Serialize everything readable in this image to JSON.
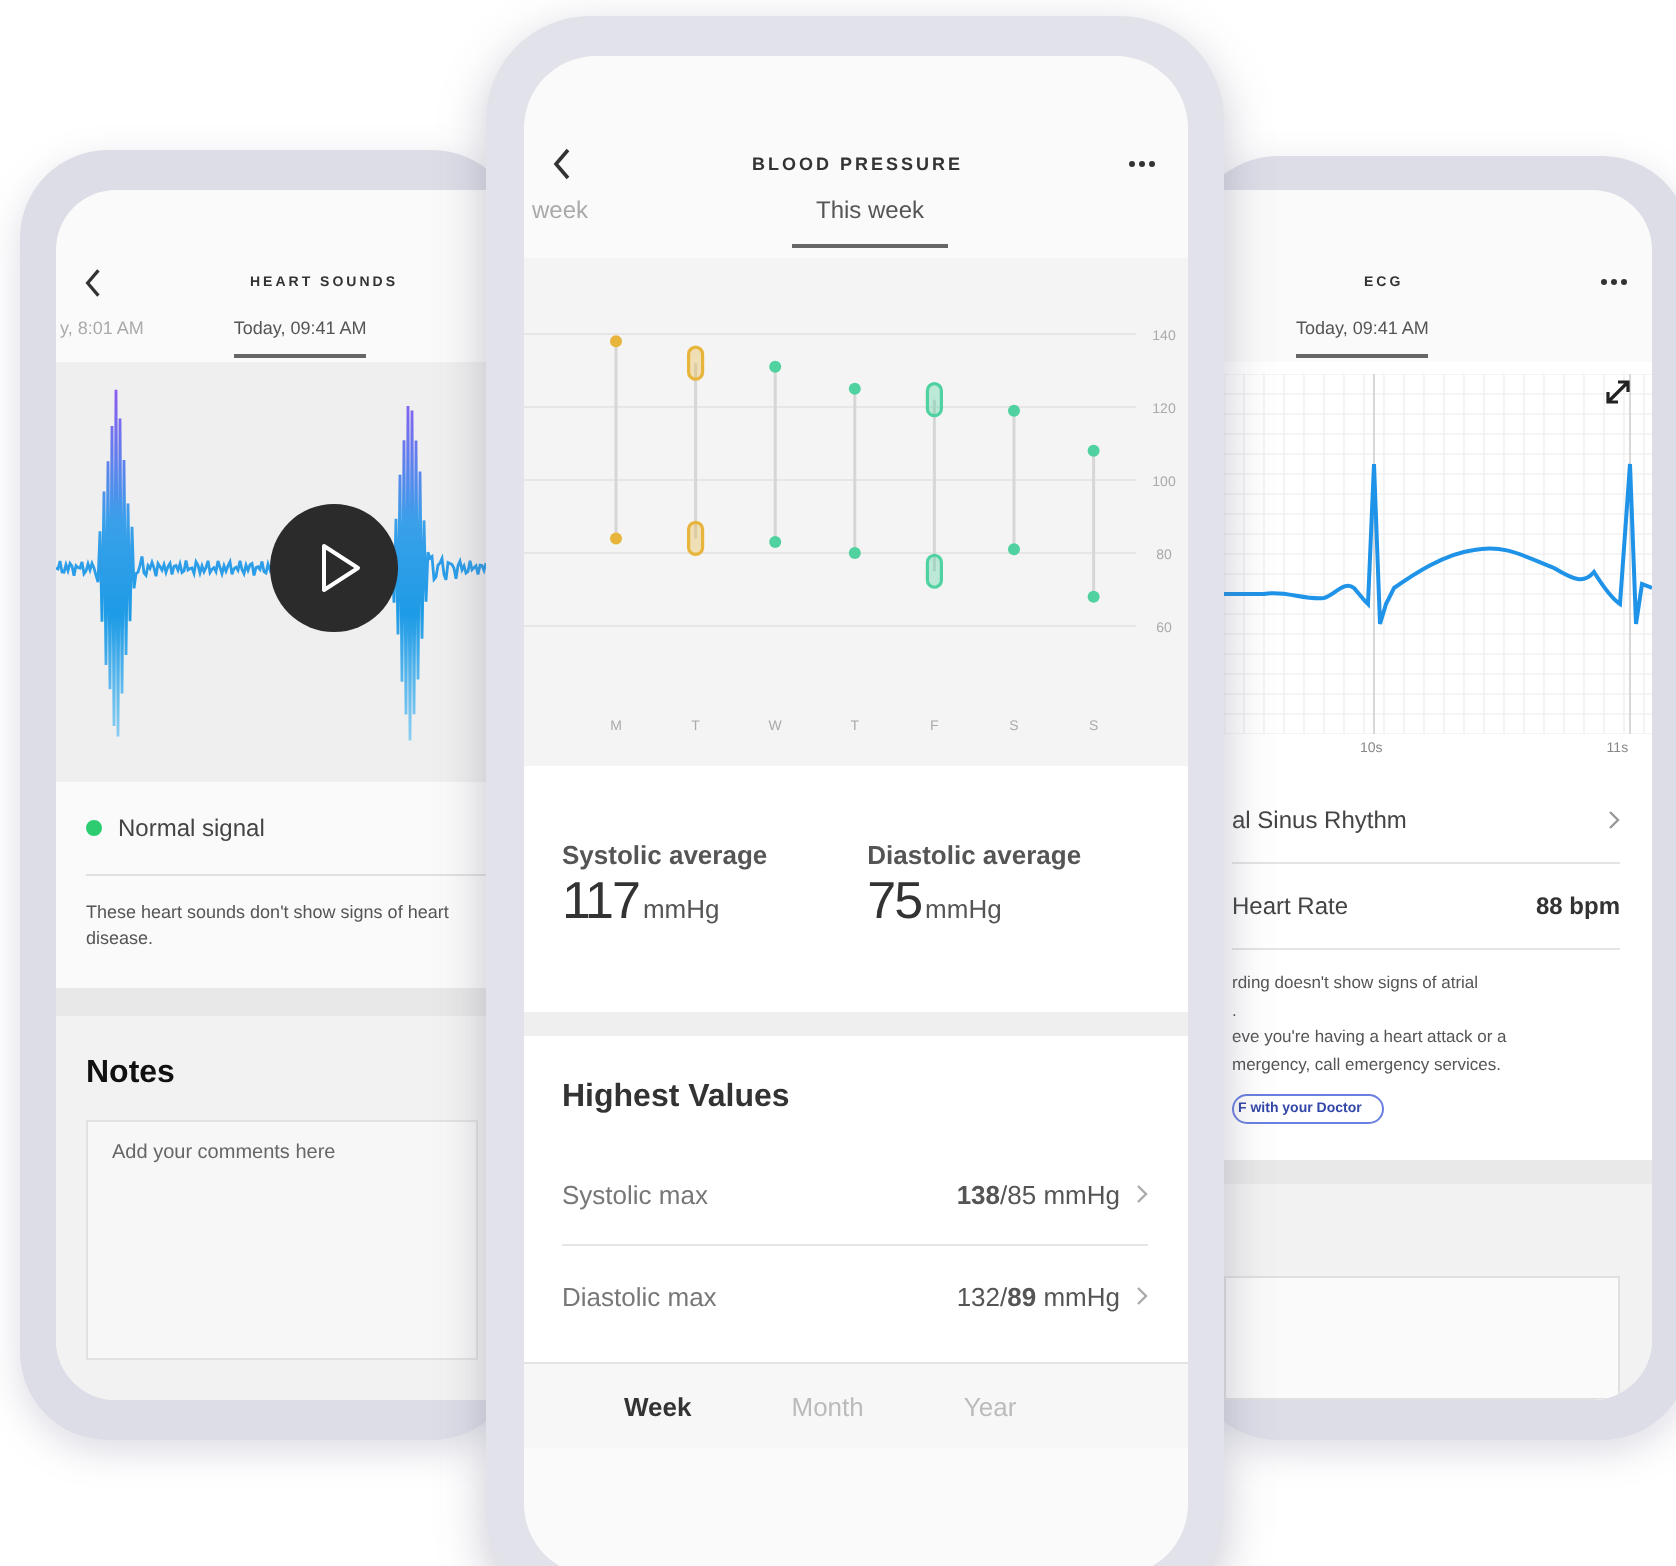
{
  "heart_sounds_screen": {
    "title": "HEART SOUNDS",
    "tabs": [
      {
        "label": "y, 8:01 AM",
        "selected": false
      },
      {
        "label": "Today, 09:41 AM",
        "selected": true
      }
    ],
    "status": {
      "label": "Normal signal",
      "color": "#2ecc71"
    },
    "description": "These heart sounds don't show signs of heart disease.",
    "notes": {
      "heading": "Notes",
      "placeholder": "Add your comments here"
    }
  },
  "blood_pressure_screen": {
    "title": "BLOOD PRESSURE",
    "tabs": [
      {
        "label": "week",
        "selected": false
      },
      {
        "label": "This week",
        "selected": true
      }
    ],
    "chart_data": {
      "type": "scatter",
      "categories": [
        "M",
        "T",
        "W",
        "T",
        "F",
        "S",
        "S"
      ],
      "ylim": [
        60,
        140
      ],
      "yticks": [
        60,
        80,
        100,
        120,
        140
      ],
      "series": [
        {
          "color": "#e8b53c",
          "values": [
            138,
            132,
            null,
            null,
            null,
            null,
            null
          ]
        },
        {
          "color": "#e8b53c",
          "values": [
            84,
            84,
            null,
            null,
            null,
            null,
            null
          ]
        },
        {
          "color": "#4fd1a0",
          "values": [
            null,
            null,
            131,
            125,
            122,
            119,
            108
          ]
        },
        {
          "color": "#4fd1a0",
          "values": [
            null,
            null,
            83,
            80,
            75,
            81,
            68
          ]
        }
      ],
      "grid": true,
      "annotations": [
        {
          "x": "T"
        },
        {
          "x": "F"
        }
      ]
    },
    "averages": [
      {
        "label": "Systolic average",
        "value": "117",
        "unit": "mmHg"
      },
      {
        "label": "Diastolic average",
        "value": "75",
        "unit": "mmHg"
      }
    ],
    "highest_values": {
      "heading": "Highest Values",
      "rows": [
        {
          "label": "Systolic max",
          "value": "**138**/85 mmHg"
        },
        {
          "label": "Diastolic max",
          "value": "132/**89** mmHg"
        }
      ]
    },
    "bottom_tabs": [
      {
        "label": "Week",
        "selected": true
      },
      {
        "label": "Month",
        "selected": false
      },
      {
        "label": "Year",
        "selected": false
      }
    ]
  },
  "ecg_screen": {
    "title": "ECG",
    "tabs": [
      {
        "label": "Today, 09:41 AM",
        "selected": true
      }
    ],
    "time_labels": [
      "10s",
      "11s"
    ],
    "rows": [
      {
        "kind": "link",
        "label": "al Sinus Rhythm"
      },
      {
        "kind": "value",
        "label": "Heart Rate",
        "value": "88 bpm"
      }
    ],
    "description_lines": [
      "rding doesn't show signs of atrial",
      ".",
      "eve you're having a heart attack or a",
      "mergency, call emergency services."
    ],
    "doctor_button": "F with your Doctor"
  }
}
